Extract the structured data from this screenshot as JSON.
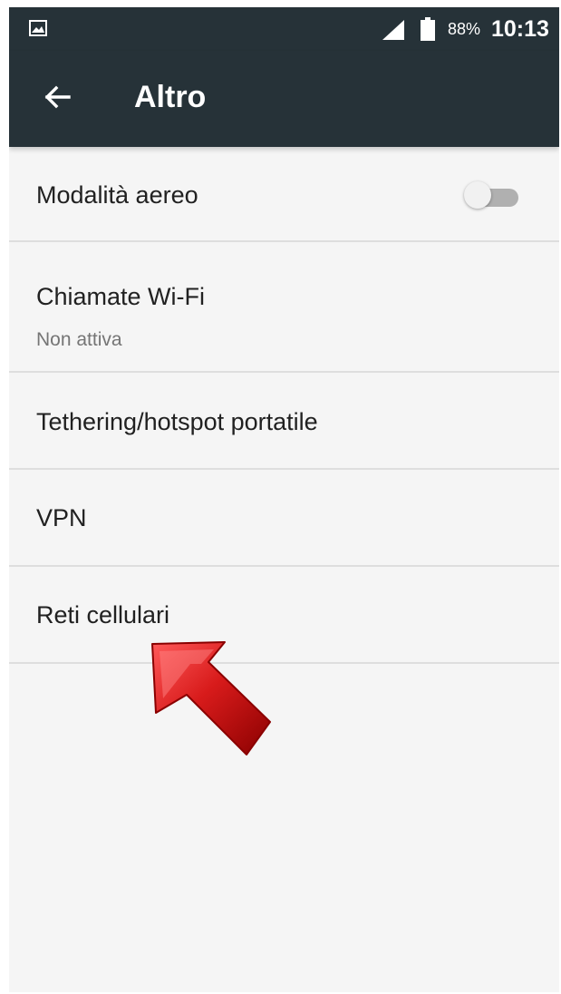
{
  "status_bar": {
    "left_icon": "image-icon",
    "signal_icon": "signal-icon",
    "battery_icon": "battery-icon",
    "battery_percent": "88%",
    "time": "10:13"
  },
  "app_bar": {
    "back_icon": "arrow-back-icon",
    "title": "Altro"
  },
  "items": [
    {
      "title": "Modalità aereo",
      "toggle": {
        "state": "off"
      }
    },
    {
      "title": "Chiamate Wi-Fi",
      "subtitle": "Non attiva"
    },
    {
      "title": "Tethering/hotspot portatile"
    },
    {
      "title": "VPN"
    },
    {
      "title": "Reti cellulari"
    }
  ],
  "overlay": {
    "arrow_icon": "red-arrow-icon",
    "arrow_color": "#d81b1b"
  },
  "colors": {
    "appbar": "#263238",
    "background": "#f5f5f5",
    "divider": "#dedede",
    "primary_text": "#212121",
    "secondary_text": "#757575",
    "toggle_track": "#b0b0b0"
  }
}
